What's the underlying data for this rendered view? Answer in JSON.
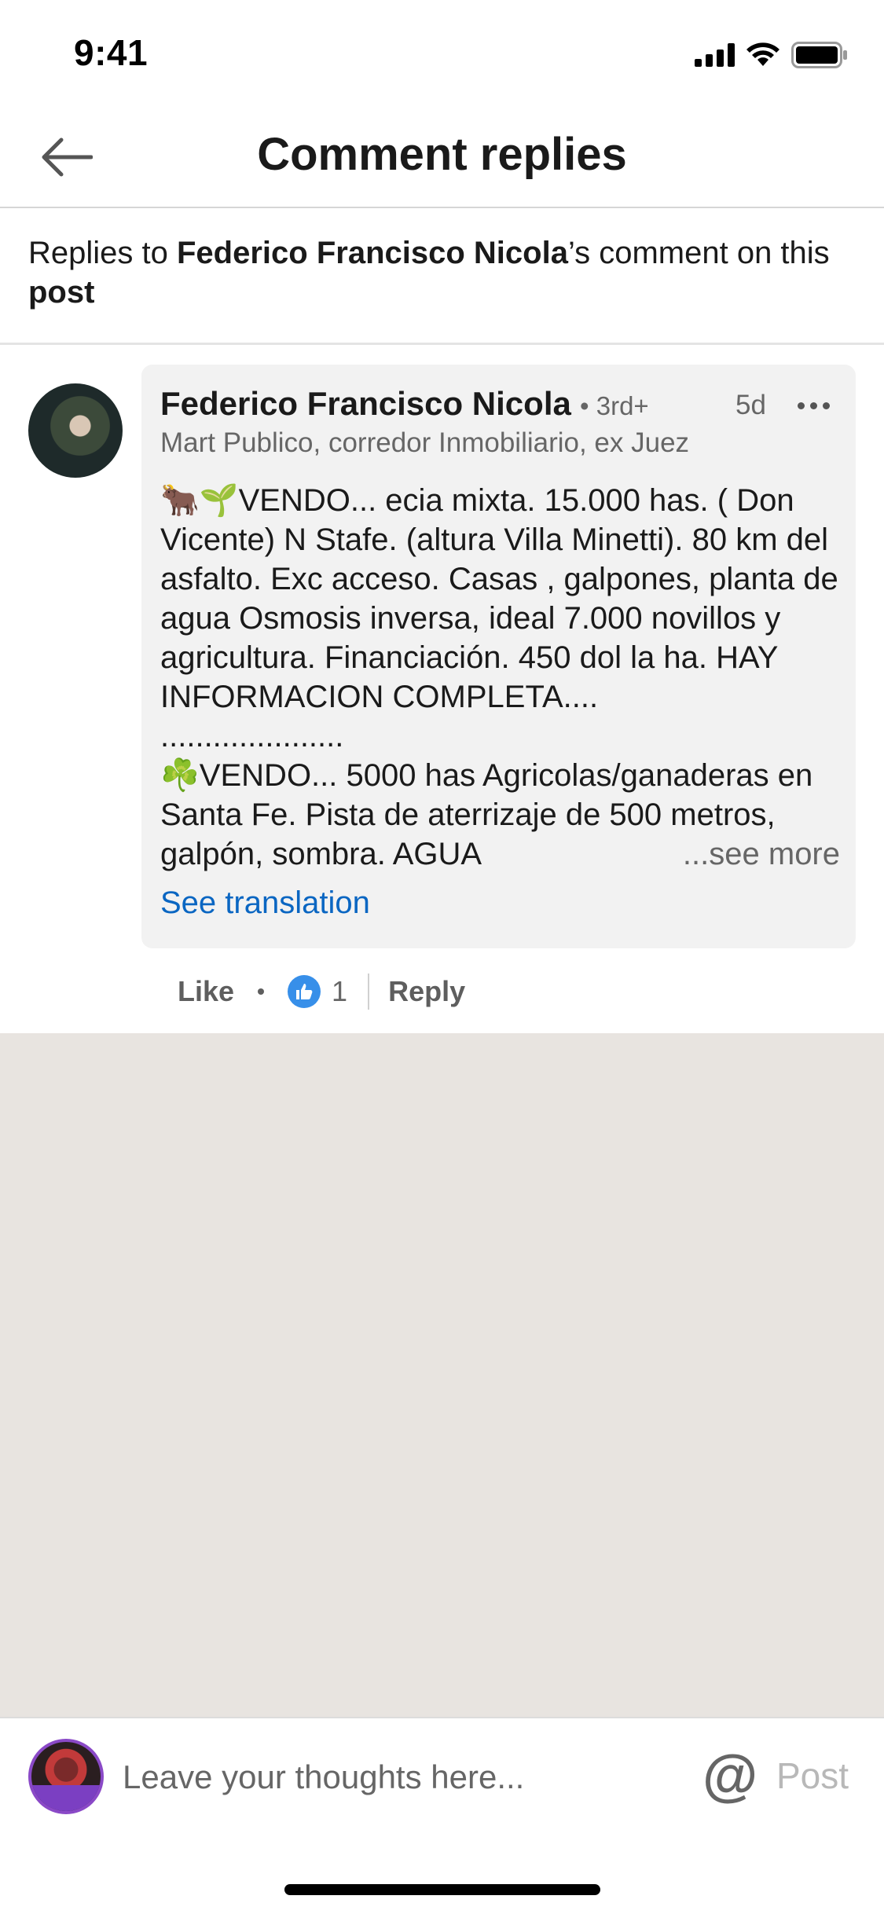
{
  "status_bar": {
    "time": "9:41"
  },
  "header": {
    "title": "Comment replies"
  },
  "replies_to": {
    "prefix": "Replies to ",
    "name": "Federico Francisco Nicola",
    "middle": "’s comment on this ",
    "post": "post"
  },
  "comment": {
    "author": "Federico Francisco Nicola",
    "degree": "• 3rd+",
    "time": "5d",
    "headline": "Mart Publico, corredor Inmobiliario, ex Juez",
    "body": "🐂🌱VENDO... ecia mixta. 15.000 has. ( Don Vicente) N Stafe. (altura Villa Minetti). 80 km del asfalto. Exc acceso. Casas , galpones, planta de agua Osmosis inversa, ideal 7.000 novillos y agricultura. Financiación. 450 dol la ha.  HAY INFORMACION COMPLETA....\n.....................\n☘️VENDO... 5000 has Agricolas/ganaderas en Santa Fe. Pista de aterrizaje de 500 metros, galpón, sombra. AGUA",
    "see_more": "...see more",
    "see_translation": "See translation",
    "actions": {
      "like": "Like",
      "like_count": "1",
      "reply": "Reply"
    }
  },
  "composer": {
    "placeholder": "Leave your thoughts here...",
    "at_symbol": "@",
    "post_label": "Post"
  },
  "colors": {
    "link_blue": "#0a66c2",
    "bubble_bg": "#f2f2f2",
    "empty_bg": "#e8e4e0",
    "like_blue": "#378fe9"
  }
}
